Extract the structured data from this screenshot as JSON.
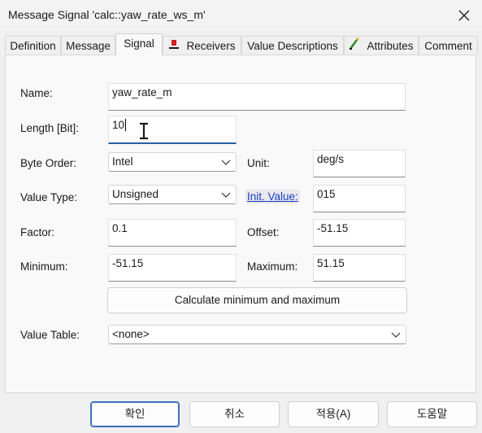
{
  "window": {
    "title": "Message Signal 'calc::yaw_rate_ws_m'"
  },
  "tabs": [
    {
      "label": "Definition",
      "icon": null
    },
    {
      "label": "Message",
      "icon": null
    },
    {
      "label": "Signal",
      "icon": null
    },
    {
      "label": "Receivers",
      "icon": "receiver-icon"
    },
    {
      "label": "Value Descriptions",
      "icon": null
    },
    {
      "label": "Attributes",
      "icon": "attributes-icon"
    },
    {
      "label": "Comment",
      "icon": null
    }
  ],
  "active_tab": "Signal",
  "form": {
    "name_label": "Name:",
    "name_value": "yaw_rate_m",
    "length_label": "Length [Bit]:",
    "length_value": "10",
    "byte_order_label": "Byte Order:",
    "byte_order_value": "Intel",
    "unit_label": "Unit:",
    "unit_value": "deg/s",
    "value_type_label": "Value Type:",
    "value_type_value": "Unsigned",
    "init_value_label": "Init. Value:",
    "init_value": "015",
    "factor_label": "Factor:",
    "factor_value": "0.1",
    "offset_label": "Offset:",
    "offset_value": "-51.15",
    "minimum_label": "Minimum:",
    "minimum_value": "-51.15",
    "maximum_label": "Maximum:",
    "maximum_value": "51.15",
    "calc_button": "Calculate minimum and maximum",
    "value_table_label": "Value Table:",
    "value_table_value": "<none>"
  },
  "buttons": {
    "ok": "확인",
    "cancel": "취소",
    "apply": "적용(A)",
    "help": "도움말"
  },
  "colors": {
    "link": "#1c3fbf",
    "focus_underline": "#2a5ea8",
    "default_button_border": "#3c6fc0"
  }
}
